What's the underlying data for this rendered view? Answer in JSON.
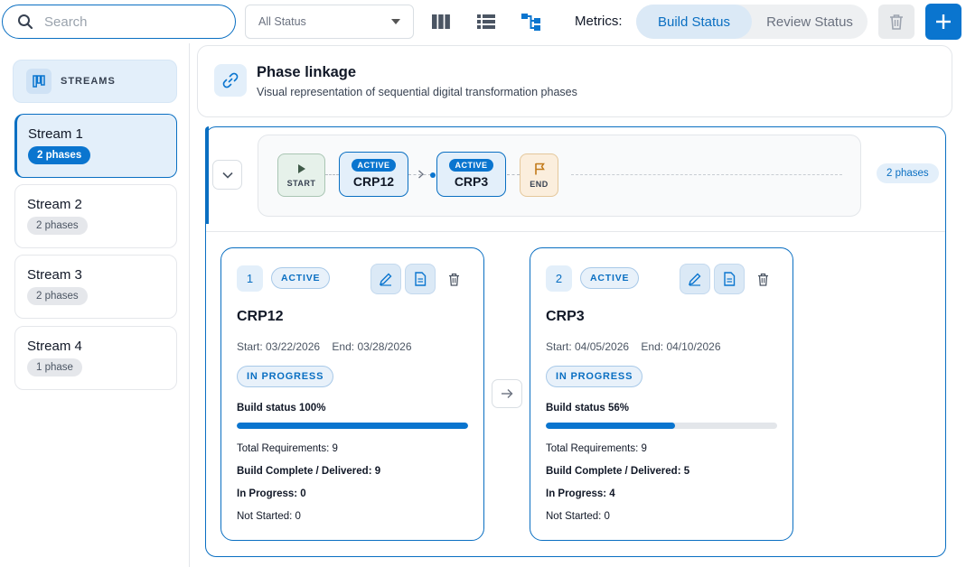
{
  "toolbar": {
    "search_placeholder": "Search",
    "status_filter": "All Status",
    "views": [
      "board-view-icon",
      "list-view-icon",
      "hierarchy-view-icon"
    ],
    "metrics_label": "Metrics:",
    "metric_options": [
      "Build Status",
      "Review Status"
    ],
    "active_metric": "Build Status"
  },
  "sidebar": {
    "header": "STREAMS",
    "streams": [
      {
        "name": "Stream 1",
        "phases": "2 phases",
        "selected": true
      },
      {
        "name": "Stream 2",
        "phases": "2 phases",
        "selected": false
      },
      {
        "name": "Stream 3",
        "phases": "2 phases",
        "selected": false
      },
      {
        "name": "Stream 4",
        "phases": "1 phase",
        "selected": false
      }
    ]
  },
  "header": {
    "title": "Phase linkage",
    "subtitle": "Visual representation of sequential digital transformation phases"
  },
  "timeline": {
    "start_label": "START",
    "end_label": "END",
    "phases": [
      {
        "badge": "ACTIVE",
        "name": "CRP12"
      },
      {
        "badge": "ACTIVE",
        "name": "CRP3"
      }
    ],
    "count": "2 phases"
  },
  "cards": [
    {
      "index": "1",
      "state": "ACTIVE",
      "name": "CRP12",
      "start": "Start: 03/22/2026",
      "end": "End: 03/28/2026",
      "progress_state": "IN PROGRESS",
      "build_label": "Build status 100%",
      "build_value": 100,
      "total": "Total Requirements: 9",
      "complete": "Build Complete / Delivered: 9",
      "in_progress": "In Progress: 0",
      "not_started": "Not Started: 0"
    },
    {
      "index": "2",
      "state": "ACTIVE",
      "name": "CRP3",
      "start": "Start: 04/05/2026",
      "end": "End: 04/10/2026",
      "progress_state": "IN PROGRESS",
      "build_label": "Build status 56%",
      "build_value": 56,
      "total": "Total Requirements: 9",
      "complete": "Build Complete / Delivered: 5",
      "in_progress": "In Progress: 4",
      "not_started": "Not Started: 0"
    }
  ],
  "colors": {
    "accent": "#0a75cf",
    "accent_light": "#e3effa",
    "start_bg": "#e6f1ea",
    "end_bg": "#fbeedd"
  }
}
